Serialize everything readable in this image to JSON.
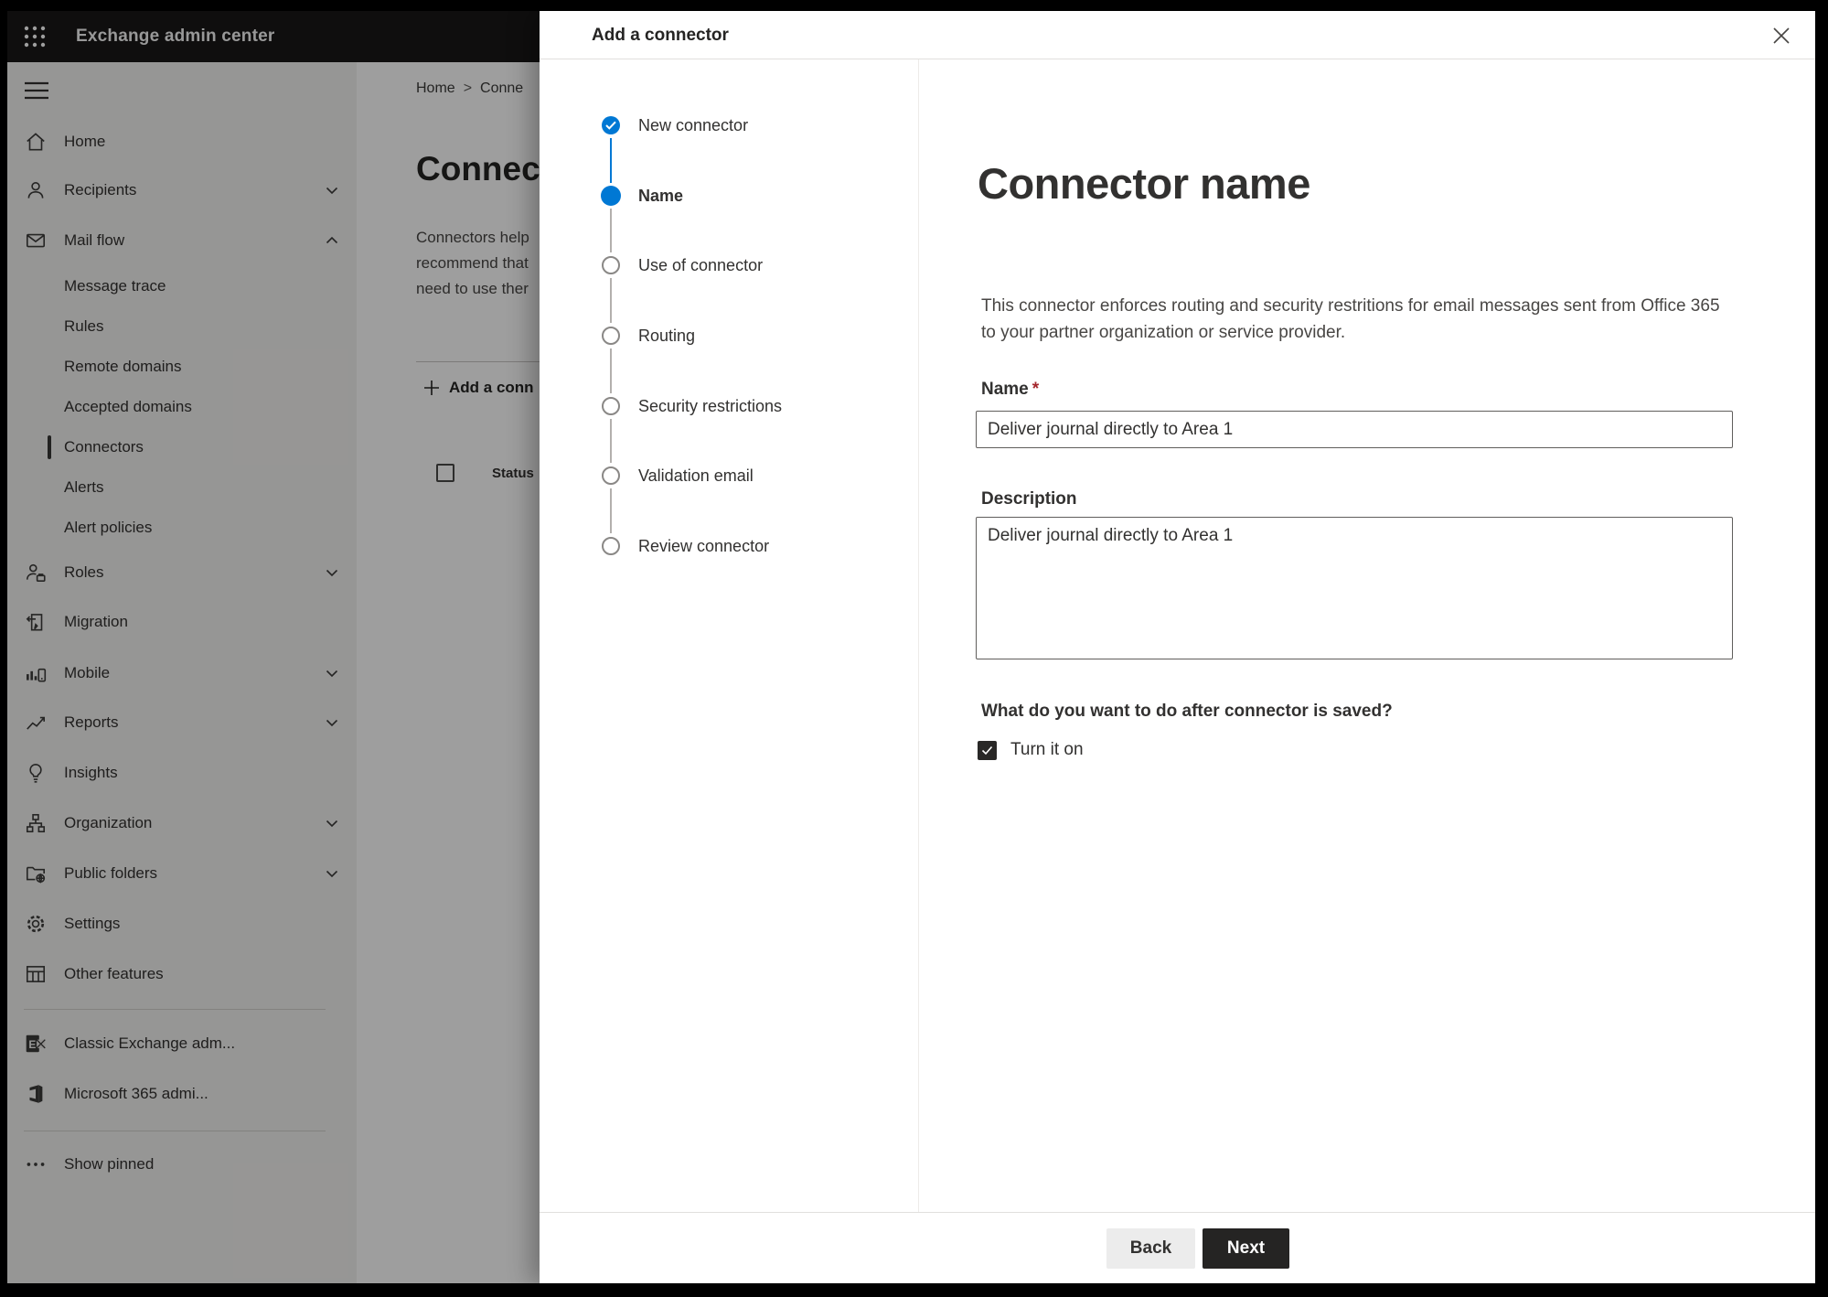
{
  "app": {
    "title": "Exchange admin center"
  },
  "sidebar": {
    "items": [
      {
        "label": "Home",
        "icon": "home-icon",
        "level": 1,
        "chevron": "none",
        "selected": false
      },
      {
        "label": "Recipients",
        "icon": "person-icon",
        "level": 1,
        "chevron": "down",
        "selected": false
      },
      {
        "label": "Mail flow",
        "icon": "mail-icon",
        "level": 1,
        "chevron": "up",
        "selected": false
      },
      {
        "label": "Message trace",
        "icon": "none",
        "level": 2,
        "chevron": "none",
        "selected": false
      },
      {
        "label": "Rules",
        "icon": "none",
        "level": 2,
        "chevron": "none",
        "selected": false
      },
      {
        "label": "Remote domains",
        "icon": "none",
        "level": 2,
        "chevron": "none",
        "selected": false
      },
      {
        "label": "Accepted domains",
        "icon": "none",
        "level": 2,
        "chevron": "none",
        "selected": false
      },
      {
        "label": "Connectors",
        "icon": "none",
        "level": 2,
        "chevron": "none",
        "selected": true
      },
      {
        "label": "Alerts",
        "icon": "none",
        "level": 2,
        "chevron": "none",
        "selected": false
      },
      {
        "label": "Alert policies",
        "icon": "none",
        "level": 2,
        "chevron": "none",
        "selected": false
      },
      {
        "label": "Roles",
        "icon": "roles-icon",
        "level": 1,
        "chevron": "down",
        "selected": false
      },
      {
        "label": "Migration",
        "icon": "migration-icon",
        "level": 1,
        "chevron": "none",
        "selected": false
      },
      {
        "label": "Mobile",
        "icon": "mobile-icon",
        "level": 1,
        "chevron": "down",
        "selected": false
      },
      {
        "label": "Reports",
        "icon": "reports-icon",
        "level": 1,
        "chevron": "down",
        "selected": false
      },
      {
        "label": "Insights",
        "icon": "lightbulb-icon",
        "level": 1,
        "chevron": "none",
        "selected": false
      },
      {
        "label": "Organization",
        "icon": "organization-icon",
        "level": 1,
        "chevron": "down",
        "selected": false
      },
      {
        "label": "Public folders",
        "icon": "public-folders-icon",
        "level": 1,
        "chevron": "down",
        "selected": false
      },
      {
        "label": "Settings",
        "icon": "settings-gear-icon",
        "level": 1,
        "chevron": "none",
        "selected": false
      },
      {
        "label": "Other features",
        "icon": "other-features-icon",
        "level": 1,
        "chevron": "none",
        "selected": false
      },
      {
        "label": "Classic Exchange adm...",
        "icon": "classic-exchange-icon",
        "level": 1,
        "chevron": "none",
        "selected": false
      },
      {
        "label": "Microsoft 365 admi...",
        "icon": "microsoft-365-icon",
        "level": 1,
        "chevron": "none",
        "selected": false
      },
      {
        "label": "Show pinned",
        "icon": "more-dots-icon",
        "level": 1,
        "chevron": "none",
        "selected": false
      }
    ]
  },
  "background": {
    "breadcrumb": {
      "home": "Home",
      "separator": ">",
      "current": "Conne"
    },
    "heading": "Connec",
    "paragraph_lines": [
      "Connectors help",
      "recommend that",
      "need to use ther"
    ],
    "toolbar": {
      "add_button": "Add a conn"
    },
    "table": {
      "status_column": "Status"
    }
  },
  "modal": {
    "title": "Add a connector",
    "steps": [
      {
        "label": "New connector",
        "state": "completed"
      },
      {
        "label": "Name",
        "state": "current"
      },
      {
        "label": "Use of connector",
        "state": "upcoming"
      },
      {
        "label": "Routing",
        "state": "upcoming"
      },
      {
        "label": "Security restrictions",
        "state": "upcoming"
      },
      {
        "label": "Validation email",
        "state": "upcoming"
      },
      {
        "label": "Review connector",
        "state": "upcoming"
      }
    ],
    "content": {
      "heading": "Connector name",
      "description_line1": "This connector enforces routing and security restritions for email messages sent from Office 365",
      "description_line2": "to your partner organization or service provider.",
      "name_label": "Name",
      "required_mark": "*",
      "name_value": "Deliver journal directly to Area 1",
      "description_label": "Description",
      "description_value": "Deliver journal directly to Area 1",
      "after_save_question": "What do you want to do after connector is saved?",
      "turn_on_label": "Turn it on",
      "turn_on_checked": true
    },
    "footer": {
      "back_label": "Back",
      "next_label": "Next"
    }
  },
  "colors": {
    "accent_blue": "#0078d4",
    "next_button": "#252423",
    "required_red": "#a4262c",
    "topbar": "#191818"
  }
}
